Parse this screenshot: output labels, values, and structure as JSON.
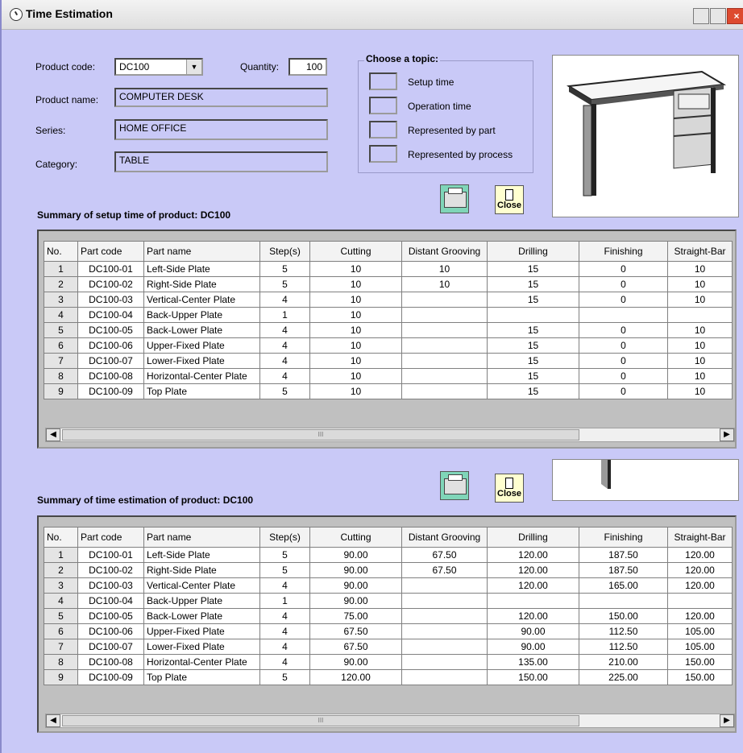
{
  "window": {
    "title": "Time Estimation"
  },
  "product": {
    "code_label": "Product code:",
    "code_value": "DC100",
    "qty_label": "Quantity:",
    "qty_value": "100",
    "name_label": "Product name:",
    "name_value": "COMPUTER DESK",
    "series_label": "Series:",
    "series_value": "HOME OFFICE",
    "category_label": "Category:",
    "category_value": "TABLE"
  },
  "topic": {
    "title": "Choose a topic:",
    "options": [
      "Setup time",
      "Operation time",
      "Represented by part",
      "Represented by process"
    ]
  },
  "buttons": {
    "close_label": "Close"
  },
  "setup": {
    "title_prefix": "Summary of setup time of product:",
    "product": "DC100",
    "headers": [
      "No.",
      "Part code",
      "Part name",
      "Step(s)",
      "Cutting",
      "Distant Grooving",
      "Drilling",
      "Finishing",
      "Straight-Bar"
    ],
    "rows": [
      [
        "1",
        "DC100-01",
        "Left-Side Plate",
        "5",
        "10",
        "10",
        "15",
        "0",
        "10"
      ],
      [
        "2",
        "DC100-02",
        "Right-Side Plate",
        "5",
        "10",
        "10",
        "15",
        "0",
        "10"
      ],
      [
        "3",
        "DC100-03",
        "Vertical-Center Plate",
        "4",
        "10",
        "",
        "15",
        "0",
        "10"
      ],
      [
        "4",
        "DC100-04",
        "Back-Upper Plate",
        "1",
        "10",
        "",
        "",
        "",
        ""
      ],
      [
        "5",
        "DC100-05",
        "Back-Lower Plate",
        "4",
        "10",
        "",
        "15",
        "0",
        "10"
      ],
      [
        "6",
        "DC100-06",
        "Upper-Fixed Plate",
        "4",
        "10",
        "",
        "15",
        "0",
        "10"
      ],
      [
        "7",
        "DC100-07",
        "Lower-Fixed Plate",
        "4",
        "10",
        "",
        "15",
        "0",
        "10"
      ],
      [
        "8",
        "DC100-08",
        "Horizontal-Center Plate",
        "4",
        "10",
        "",
        "15",
        "0",
        "10"
      ],
      [
        "9",
        "DC100-09",
        "Top Plate",
        "5",
        "10",
        "",
        "15",
        "0",
        "10"
      ]
    ]
  },
  "estimate": {
    "title_prefix": "Summary of time estimation of product:",
    "product": "DC100",
    "headers": [
      "No.",
      "Part code",
      "Part name",
      "Step(s)",
      "Cutting",
      "Distant Grooving",
      "Drilling",
      "Finishing",
      "Straight-Bar"
    ],
    "rows": [
      [
        "1",
        "DC100-01",
        "Left-Side Plate",
        "5",
        "90.00",
        "67.50",
        "120.00",
        "187.50",
        "120.00"
      ],
      [
        "2",
        "DC100-02",
        "Right-Side Plate",
        "5",
        "90.00",
        "67.50",
        "120.00",
        "187.50",
        "120.00"
      ],
      [
        "3",
        "DC100-03",
        "Vertical-Center Plate",
        "4",
        "90.00",
        "",
        "120.00",
        "165.00",
        "120.00"
      ],
      [
        "4",
        "DC100-04",
        "Back-Upper Plate",
        "1",
        "90.00",
        "",
        "",
        "",
        ""
      ],
      [
        "5",
        "DC100-05",
        "Back-Lower Plate",
        "4",
        "75.00",
        "",
        "120.00",
        "150.00",
        "120.00"
      ],
      [
        "6",
        "DC100-06",
        "Upper-Fixed Plate",
        "4",
        "67.50",
        "",
        "90.00",
        "112.50",
        "105.00"
      ],
      [
        "7",
        "DC100-07",
        "Lower-Fixed Plate",
        "4",
        "67.50",
        "",
        "90.00",
        "112.50",
        "105.00"
      ],
      [
        "8",
        "DC100-08",
        "Horizontal-Center Plate",
        "4",
        "90.00",
        "",
        "135.00",
        "210.00",
        "150.00"
      ],
      [
        "9",
        "DC100-09",
        "Top Plate",
        "5",
        "120.00",
        "",
        "150.00",
        "225.00",
        "150.00"
      ]
    ]
  },
  "scroll": {
    "thumb_grip": "III"
  }
}
